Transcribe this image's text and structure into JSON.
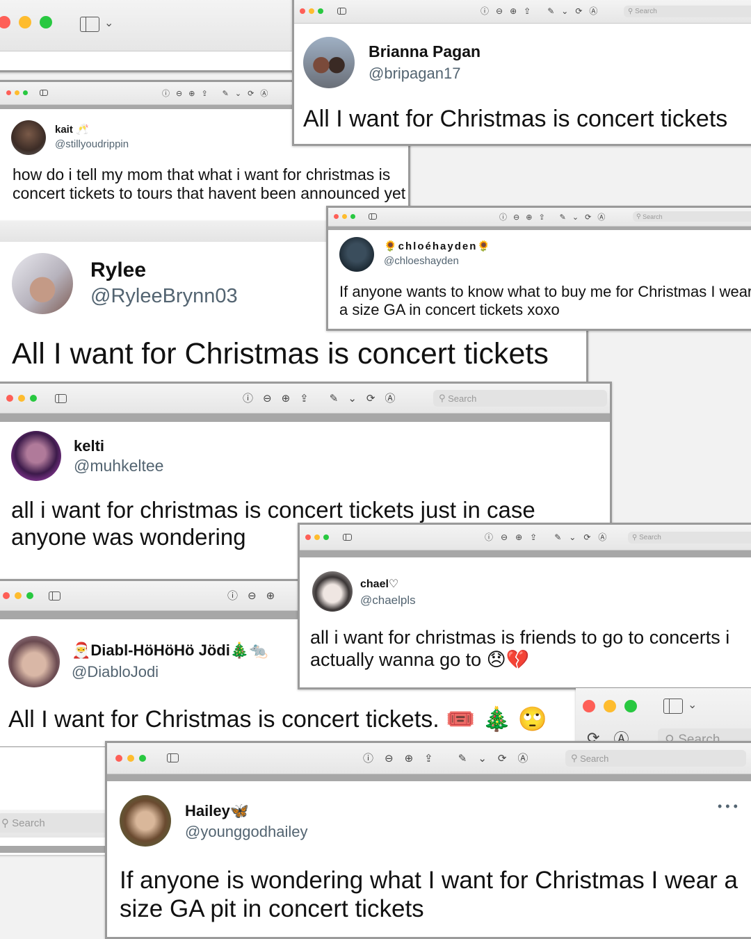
{
  "tweets": [
    {
      "name": "Brianna Pagan",
      "handle": "@bripagan17",
      "text": "All I want for Christmas is concert tickets"
    },
    {
      "name": "kait 🥂",
      "handle": "@stillyoudrippin",
      "text": "how do i tell my mom that what i want for christmas is concert tickets to tours that havent been announced yet"
    },
    {
      "name": "🌻chloéhayden🌻",
      "handle": "@chloeshayden",
      "text": "If anyone wants to know what to buy me for Christmas I wear a size GA in concert tickets xoxo"
    },
    {
      "name": "Rylee",
      "handle": "@RyleeBrynn03",
      "text": "All I want for Christmas is concert tickets"
    },
    {
      "name": "kelti",
      "handle": "@muhkeltee",
      "text": "all i want for christmas is concert tickets just in case anyone was wondering"
    },
    {
      "name": "chael♡",
      "handle": "@chaelpls",
      "text": "all i want for christmas is friends to go to concerts i actually wanna go to 😞💔"
    },
    {
      "name": "🎅Diabl-HöHöHö Jödi🎄🐀",
      "handle": "@DiabloJodi",
      "text": "All I want for Christmas is concert tickets. 🎟️ 🎄 🙄"
    },
    {
      "name": "Hailey🦋",
      "handle": "@younggodhailey",
      "text": "If anyone is wondering what I want for Christmas I wear a size GA pit in concert tickets"
    }
  ],
  "toolbar": {
    "search_placeholder": "Search",
    "icons": [
      "info-icon",
      "zoom-out-icon",
      "zoom-in-icon",
      "share-icon",
      "markup-pen-icon",
      "chevron-down-icon",
      "rotate-icon",
      "annotate-icon"
    ]
  },
  "colors": {
    "traffic_red": "#fe5f57",
    "traffic_yellow": "#febc2e",
    "traffic_green": "#28c840",
    "handle_gray": "#536471"
  }
}
